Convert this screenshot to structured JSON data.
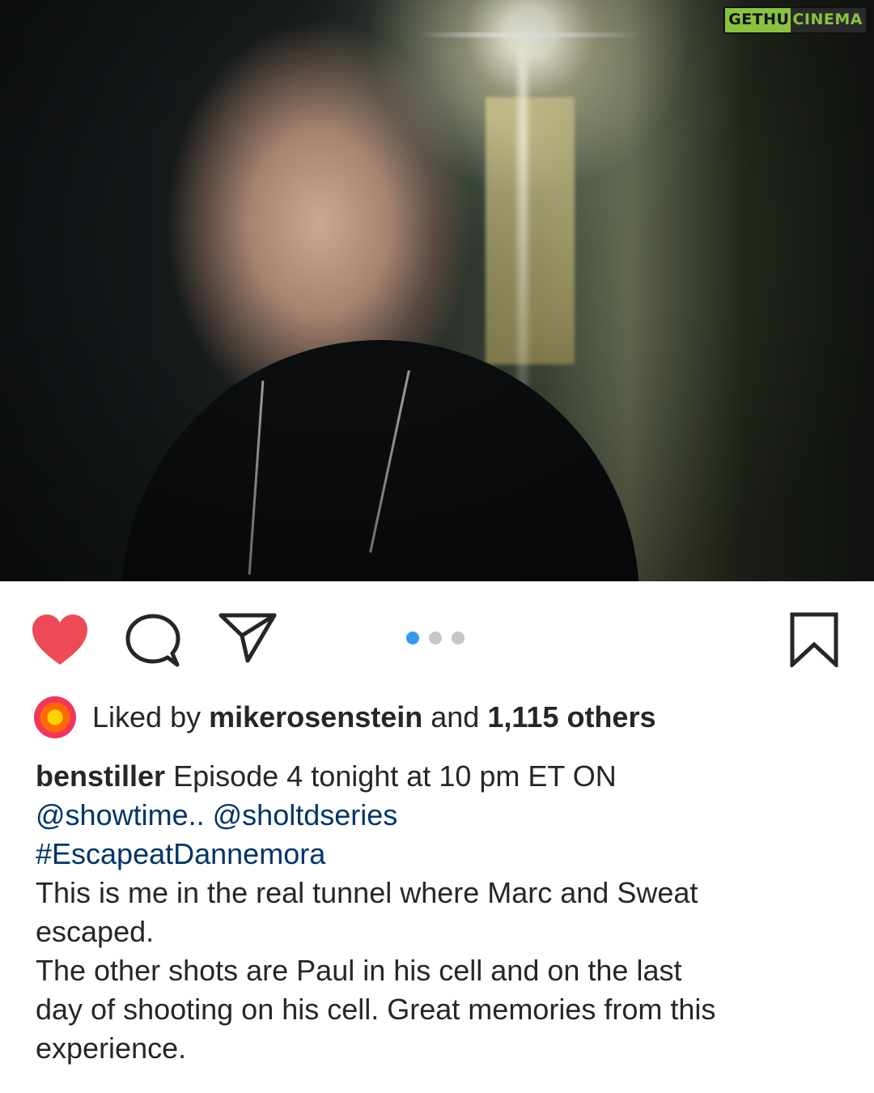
{
  "post": {
    "watermark": {
      "part1": "GETHU",
      "part2": "CINEMA"
    }
  },
  "actions": {
    "like_icon": "heart-filled-icon",
    "comment_icon": "speech-bubble-icon",
    "share_icon": "paper-plane-icon",
    "save_icon": "bookmark-icon",
    "like_color": "#ed4956",
    "carousel": {
      "total": 3,
      "active_index": 0,
      "active_color": "#3897f0"
    }
  },
  "likes": {
    "prefix": "Liked by",
    "user": "mikerosenstein",
    "connector": "and",
    "others": "1,115 others"
  },
  "caption": {
    "username": "benstiller",
    "line1_text": "Episode 4 tonight at 10 pm ET ON",
    "mention1": "@showtime..",
    "mention2": "@sholtdseries",
    "hashtag": "#EscapeatDannemora",
    "line4": "This is me in the real tunnel where Marc and Sweat",
    "line5": "escaped.",
    "line6": "The other shots are Paul in his cell and on the last",
    "line7": "day of shooting on his cell. Great memories from this",
    "line8": "experience.",
    "link_color": "#003569"
  }
}
